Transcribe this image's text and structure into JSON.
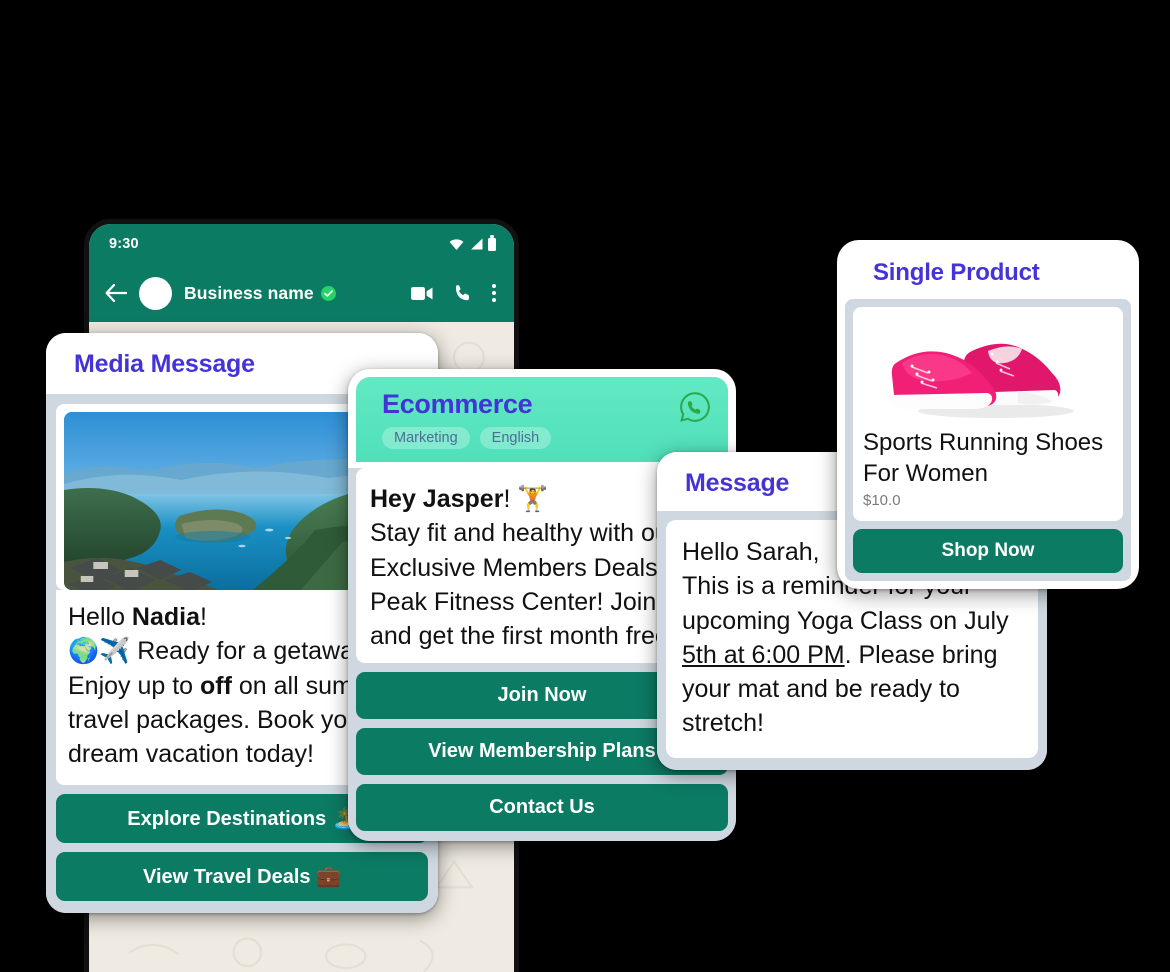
{
  "phone": {
    "status_bar": {
      "time": "9:30",
      "icons": [
        "wifi-icon",
        "signal-icon",
        "battery-icon"
      ]
    },
    "app_bar": {
      "back_label": "back-arrow-icon",
      "business_name": "Business name",
      "verified_badge": "verified-check-icon",
      "actions": [
        "video-call-icon",
        "voice-call-icon",
        "overflow-menu-icon"
      ]
    }
  },
  "colors": {
    "whatsapp_green": "#0c7b64",
    "title_violet": "#4434d8",
    "mint_header": "#4fe0b9",
    "card_frame": "#cfd8e0",
    "chat_wallpaper": "#efebe2"
  },
  "cards": {
    "media": {
      "title": "Media Message",
      "image_alt": "lake-landscape-photo",
      "body_line1_prefix": "Hello ",
      "body_line1_bold": "Nadia",
      "body_line1_suffix": "!",
      "body_emoji": "🌍✈️",
      "body_rest": " Ready for a getaway? Enjoy up to ",
      "body_bold2": "off",
      "body_rest2": " on all summer travel packages. Book your dream vacation today!",
      "buttons": [
        {
          "label": "Explore Destinations 🏝️"
        },
        {
          "label": "View Travel Deals 💼"
        }
      ]
    },
    "ecommerce": {
      "title": "Ecommerce",
      "chips": [
        "Marketing",
        "English"
      ],
      "brand_icon": "whatsapp-icon",
      "greeting_bold": "Hey Jasper",
      "greeting_suffix": "! ",
      "greeting_emoji": "🏋️",
      "body": "Stay fit and healthy with our Exclusive Members Deals at Peak Fitness Center! Join now and get the first month free.",
      "buttons": [
        {
          "label": "Join Now"
        },
        {
          "label": "View Membership Plans"
        },
        {
          "label": "Contact Us"
        }
      ]
    },
    "message": {
      "title": "Message",
      "line1": "Hello Sarah,",
      "line2": "This is a reminder for your upcoming Yoga Class on July ",
      "underlined": "5th at 6:00 PM",
      "line3": ". Please bring your mat and be ready to stretch!"
    },
    "product": {
      "title": "Single Product",
      "image_alt": "pink-sneakers-photo",
      "name": "Sports Running Shoes For Women",
      "price": "$10.0",
      "button_label": "Shop Now"
    }
  }
}
